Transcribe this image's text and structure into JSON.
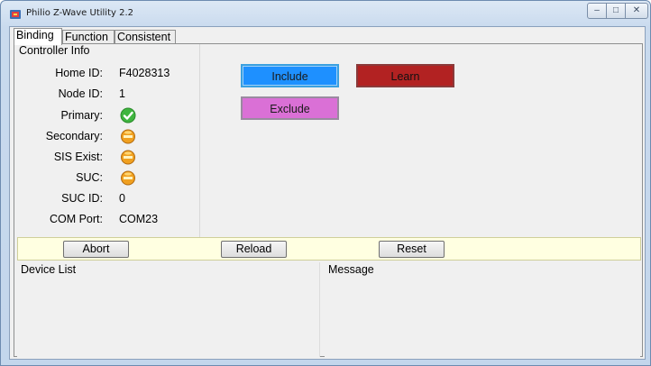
{
  "window": {
    "title": "Philio Z-Wave Utility 2.2",
    "controls": {
      "minimize": "–",
      "maximize": "□",
      "close": "✕"
    }
  },
  "tabs": [
    {
      "label": "Binding",
      "active": true
    },
    {
      "label": "Function",
      "active": false
    },
    {
      "label": "Consistent",
      "active": false
    }
  ],
  "controller_info": {
    "title": "Controller Info",
    "home_id": {
      "label": "Home ID:",
      "value": "F4028313"
    },
    "node_id": {
      "label": "Node ID:",
      "value": "1"
    },
    "primary": {
      "label": "Primary:",
      "icon": "check-icon"
    },
    "secondary": {
      "label": "Secondary:",
      "icon": "no-entry-icon"
    },
    "sis_exist": {
      "label": "SIS Exist:",
      "icon": "no-entry-icon"
    },
    "suc": {
      "label": "SUC:",
      "icon": "no-entry-icon"
    },
    "suc_id": {
      "label": "SUC ID:",
      "value": "0"
    },
    "com_port": {
      "label": "COM Port:",
      "value": "COM23"
    }
  },
  "actions": {
    "include": "Include",
    "learn": "Learn",
    "exclude": "Exclude"
  },
  "toolbar": {
    "abort": "Abort",
    "reload": "Reload",
    "reset": "Reset"
  },
  "panes": {
    "device_list": "Device List",
    "message": "Message"
  },
  "colors": {
    "include": "#1e90ff",
    "learn": "#b22222",
    "exclude": "#da70d6",
    "toolbar_bg": "#ffffe1"
  }
}
